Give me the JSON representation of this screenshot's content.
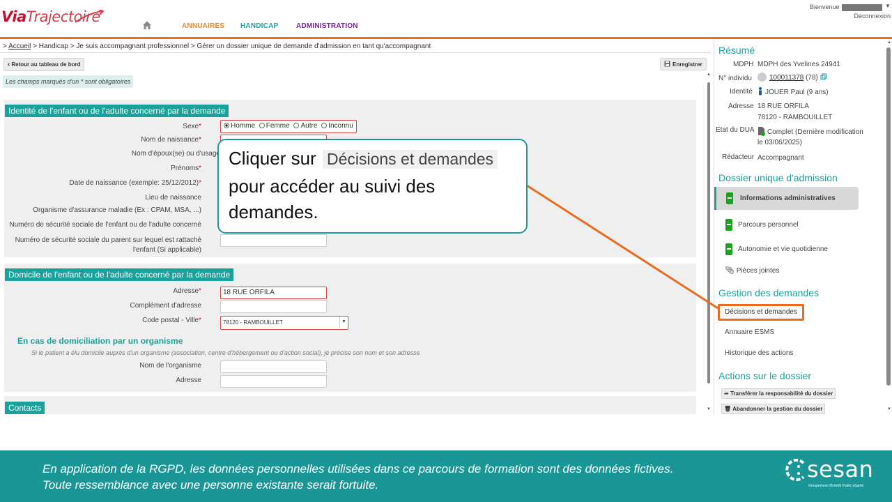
{
  "header": {
    "logo_via": "Via",
    "logo_traj": "Trajectoire",
    "nav": [
      "ANNUAIRES",
      "HANDICAP",
      "ADMINISTRATION"
    ],
    "bienvenue": "Bienvenue",
    "deconnexion": "Déconnexion"
  },
  "breadcrumb": {
    "prefix": ">",
    "accueil": "Accueil",
    "rest": "> Handicap > Je suis accompagnant professionnel > Gérer un dossier unique de demande d'admission en tant qu'accompagnant"
  },
  "toolbar": {
    "retour": "Retour au tableau de bord",
    "enregistrer": "Enregistrer"
  },
  "required_note": "Les champs marqués d'un  * sont obligatoires",
  "identite": {
    "title": "Identité de l'enfant ou de l'adulte concerné par la demande",
    "sexe_label": "Sexe",
    "sexe_options": [
      "Homme",
      "Femme",
      "Autre",
      "Inconnu"
    ],
    "nom_naissance": "Nom de naissance",
    "nom_epoux": "Nom d'époux(se) ou d'usage",
    "prenoms": "Prénoms",
    "date_naissance": "Date de naissance (exemple: 25/12/2012)",
    "lieu_naissance": "Lieu de naissance",
    "organisme": "Organisme d'assurance maladie (Ex : CPAM, MSA, ...)",
    "nss_enfant": "Numéro de sécurité sociale de l'enfant ou de l'adulte concerné",
    "nss_parent_1": "Numéro de sécurité sociale du parent sur lequel est rattaché",
    "nss_parent_2": "l'enfant (Si applicable)"
  },
  "domicile": {
    "title": "Domicile de l'enfant ou de l'adulte concerné par la demande",
    "adresse_label": "Adresse",
    "adresse_value": "18 RUE ORFILA",
    "complement": "Complément d'adresse",
    "cp_label": "Code postal - Ville",
    "cp_value": "78120 - RAMBOUILLET",
    "sub_title": "En cas de domiciliation par un organisme",
    "sub_note": "Si le patient a élu domicile auprès d'un organisme (association, centre d'hébergement ou d'action social), je précise son nom et son adresse",
    "nom_org": "Nom de l'organisme",
    "adresse_org": "Adresse"
  },
  "contacts": {
    "title": "Contacts"
  },
  "sidebar": {
    "resume_title": "Résumé",
    "mdph_k": "MDPH",
    "mdph_v": "MDPH des Yvelines 24941",
    "individu_k": "N° individu",
    "individu_link": "100011378",
    "individu_extra": "(78)",
    "identite_k": "Identité",
    "identite_v": "JOUER Paul (9 ans)",
    "adresse_k": "Adresse",
    "adresse_v1": "18 RUE ORFILA",
    "adresse_v2": "78120 - RAMBOUILLET",
    "etat_k": "Etat du DUA",
    "etat_v1": "Complet   (Dernière modification",
    "etat_v2": "le 03/06/2025)",
    "redacteur_k": "Rédacteur",
    "redacteur_v": "Accompagnant",
    "dossier_title": "Dossier unique d'admission",
    "dossier_items": [
      "Informations administratives",
      "Parcours personnel",
      "Autonomie et vie quotidienne"
    ],
    "pieces": "Pièces jointes",
    "gestion_title": "Gestion des demandes",
    "decisions": "Décisions et demandes",
    "annuaire": "Annuaire ESMS",
    "historique": "Historique des actions",
    "actions_title": "Actions sur le dossier",
    "transferer": "Transférer la responsabilité du dossier",
    "abandonner": "Abandonner la gestion du dossier"
  },
  "callout": {
    "line1_prefix": "Cliquer sur",
    "line1_chip": "Décisions et demandes",
    "line2": "pour accéder au suivi des",
    "line3": "demandes."
  },
  "footer": {
    "line1": "En application de la RGPD, les données personnelles utilisées dans ce parcours de formation sont des données fictives.",
    "line2": "Toute ressemblance avec une personne existante serait fortuite.",
    "brand": "sesan",
    "brand_sub": "Groupement d'Intérêt Public eSanté"
  },
  "colors": {
    "accent_teal": "#1aa19b",
    "accent_orange": "#ec6a1d",
    "footer_teal": "#1a9696"
  }
}
